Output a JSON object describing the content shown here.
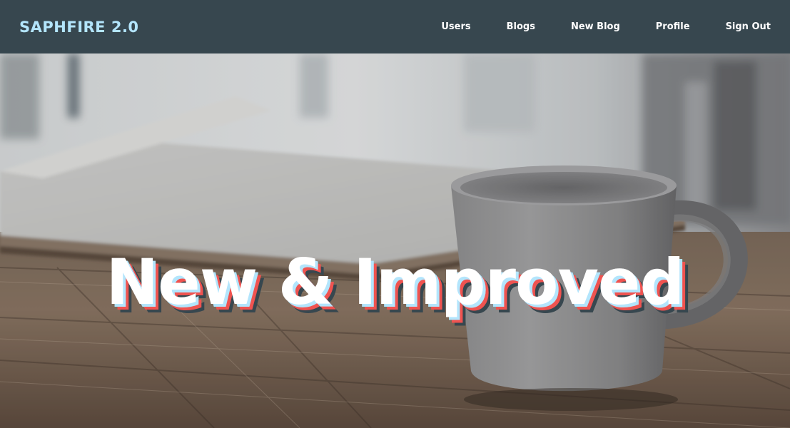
{
  "navbar": {
    "brand": "SAPHFIRE 2.0",
    "links": [
      "Users",
      "Blogs",
      "New Blog",
      "Profile",
      "Sign Out"
    ]
  },
  "hero": {
    "title": "New & Improved"
  },
  "colors": {
    "navbar_bg": "#37474f",
    "brand": "#b3e5fc",
    "shadow_light_blue": "#b3e5fc",
    "shadow_red": "#ef5350",
    "shadow_dark": "#37474f"
  }
}
